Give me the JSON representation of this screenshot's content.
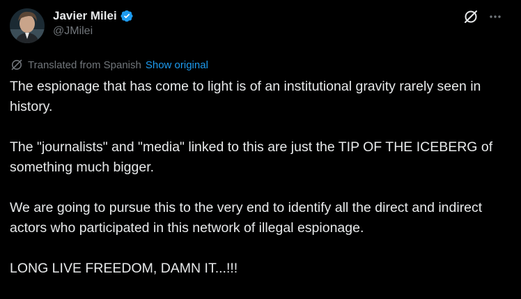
{
  "author": {
    "display_name": "Javier Milei",
    "handle": "@JMilei",
    "verified": true,
    "verified_color": "#1d9bf0",
    "avatar_icon": "profile-photo"
  },
  "header_actions": {
    "grok_icon": "grok-slash-icon",
    "more_icon": "more-dots-icon"
  },
  "translation": {
    "icon": "translate-icon",
    "label": "Translated from Spanish",
    "show_original_label": "Show original",
    "link_color": "#1d9bf0"
  },
  "tweet": {
    "paragraphs": [
      "The espionage that has come to light is of an institutional gravity rarely seen in history.",
      "The \"journalists\" and \"media\" linked to this are just the TIP OF THE ICEBERG of something much bigger.",
      "We are going to pursue this to the very end to identify all the direct and indirect actors who participated in this network of illegal espionage.",
      "LONG LIVE FREEDOM, DAMN IT...!!!"
    ]
  },
  "colors": {
    "background": "#000000",
    "text": "#e7e9ea",
    "secondary_text": "#71767b",
    "accent": "#1d9bf0"
  }
}
